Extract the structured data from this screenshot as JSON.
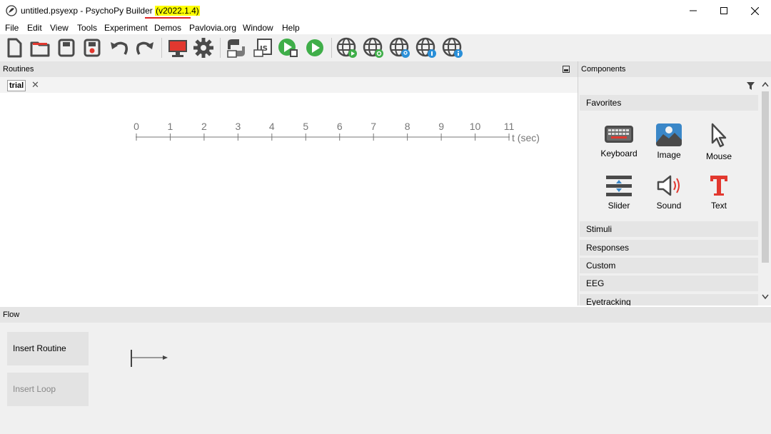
{
  "window": {
    "title_prefix": "untitled.psyexp - PsychoPy Builder ",
    "title_version": "(v2022.1.4)",
    "minimize_glyph": "—",
    "maximize_glyph": "☐",
    "close_glyph": "✕"
  },
  "menu": [
    "File",
    "Edit",
    "View",
    "Tools",
    "Experiment",
    "Demos",
    "Pavlovia.org",
    "Window",
    "Help"
  ],
  "toolbar": {
    "icons": [
      "new-file-icon",
      "open-folder-icon",
      "save-icon",
      "save-as-icon",
      "undo-icon",
      "redo-icon",
      "monitor-icon",
      "gear-icon",
      "python-icon",
      "js-icon",
      "run-tablet-icon",
      "run-play-icon",
      "globe-play-icon",
      "globe-sync-icon",
      "globe-search-icon",
      "globe-user-icon",
      "globe-info-icon"
    ]
  },
  "routines": {
    "header": "Routines",
    "tab_label": "trial",
    "tab_close": "✕",
    "timeline": {
      "ticks": [
        "0",
        "1",
        "2",
        "3",
        "4",
        "5",
        "6",
        "7",
        "8",
        "9",
        "10",
        "11"
      ],
      "unit_label": "t (sec)"
    }
  },
  "components": {
    "header": "Components",
    "favorites_label": "Favorites",
    "favorites": [
      {
        "label": "Keyboard",
        "icon": "keyboard-icon"
      },
      {
        "label": "Image",
        "icon": "image-icon"
      },
      {
        "label": "Mouse",
        "icon": "mouse-cursor-icon"
      },
      {
        "label": "Slider",
        "icon": "slider-icon"
      },
      {
        "label": "Sound",
        "icon": "speaker-icon"
      },
      {
        "label": "Text",
        "icon": "text-t-icon"
      }
    ],
    "categories": [
      "Stimuli",
      "Responses",
      "Custom",
      "EEG",
      "Eyetracking"
    ]
  },
  "flow": {
    "header": "Flow",
    "insert_routine": "Insert Routine",
    "insert_loop": "Insert Loop"
  },
  "colors": {
    "accent_green": "#3fae49",
    "icon_dark": "#4a4a4a",
    "text_red": "#e2382f",
    "highlight_yellow": "#ffff00"
  }
}
